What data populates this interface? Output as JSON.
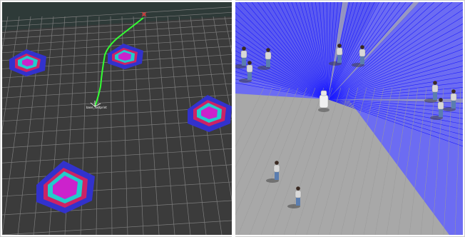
{
  "left_view": {
    "grid_color": "#8a8a8a",
    "background": "#3b3b3b",
    "path_color": "#33ff33",
    "goal_marker_color": "#dd3333",
    "robot_label": "base_footprint",
    "costmap_colors": {
      "outer": "#3232cc",
      "inflation": "#cc2266",
      "inscribed": "#22cccc",
      "lethal": "#cc22cc"
    },
    "obstacle_count": 4
  },
  "right_view": {
    "laser_color": "#2222ff",
    "floor_color": "#9e9e9e",
    "robot_color": "#f0f0f0",
    "people_count": 10,
    "shirt_color": "#d8d8d8",
    "pants_color": "#5a7db0"
  }
}
